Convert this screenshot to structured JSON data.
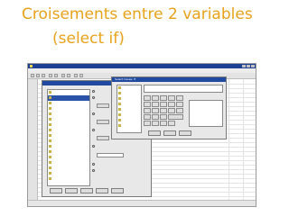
{
  "slide": {
    "title_line1": "Croisements entre 2 variables",
    "title_line2": "(select if)"
  },
  "colors": {
    "title_color": "#e8a21a",
    "titlebar": "#1d3f94",
    "selection": "#2a52a8"
  },
  "screenshot": {
    "window_title": "",
    "menu_items": [],
    "dialog1": {
      "title": "",
      "variables": [],
      "radios": [],
      "buttons": []
    },
    "dialog2": {
      "title": "Select Cases: If",
      "expression": "",
      "buttons": []
    },
    "column_values": []
  },
  "icons": [
    "window-icon",
    "variable-icon"
  ]
}
